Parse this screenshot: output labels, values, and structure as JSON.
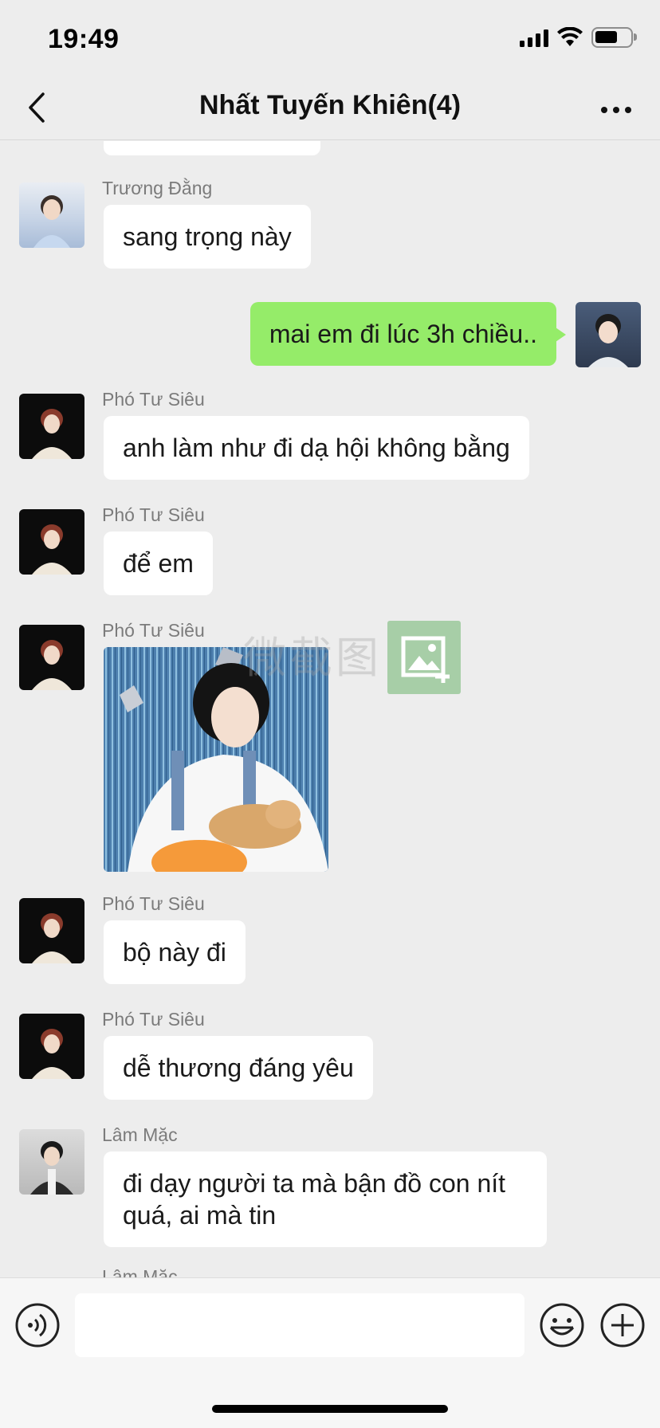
{
  "status_bar": {
    "time": "19:49"
  },
  "nav": {
    "title": "Nhất Tuyến Khiên(4)"
  },
  "messages": [
    {
      "sender": "Trương Đằng",
      "text": "sang trọng này"
    },
    {
      "text": "mai em đi lúc 3h chiều.."
    },
    {
      "sender": "Phó Tư Siêu",
      "text": "anh làm như đi dạ hội không bằng"
    },
    {
      "sender": "Phó Tư Siêu",
      "text": "để em"
    },
    {
      "sender": "Phó Tư Siêu"
    },
    {
      "sender": "Phó Tư Siêu",
      "text": "bộ này đi"
    },
    {
      "sender": "Phó Tư Siêu",
      "text": "dễ thương đáng yêu"
    },
    {
      "sender": "Lâm Mặc",
      "text": "đi dạy người ta mà bận đồ con nít quá, ai mà tin"
    },
    {
      "sender": "Lâm Mặc"
    }
  ],
  "watermark": {
    "text": "微截图"
  },
  "colors": {
    "background": "#ededed",
    "my_bubble": "#95ec69",
    "other_bubble": "#ffffff"
  }
}
